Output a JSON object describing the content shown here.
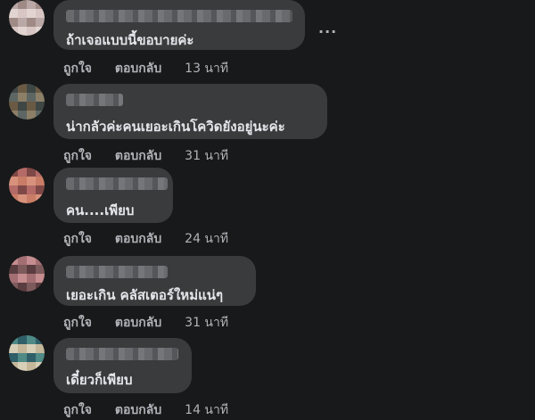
{
  "comments": [
    {
      "text": "ถ้าเจอแบบนี้ขอบายค่ะ",
      "like": "ถูกใจ",
      "reply": "ตอบกลับ",
      "time": "13 นาที",
      "avatar_colors": [
        "#b9a8a5",
        "#d7c6c3",
        "#9f8a86",
        "#e2d4d1"
      ]
    },
    {
      "text": "น่ากลัวค่ะคนเยอะเกินโควิดยังอยู่นะค่ะ",
      "like": "ถูกใจ",
      "reply": "ตอบกลับ",
      "time": "31 นาที",
      "avatar_colors": [
        "#5d6663",
        "#3f4744",
        "#8c7f68",
        "#6b5a43"
      ]
    },
    {
      "text": "คน....เพียบ",
      "like": "ถูกใจ",
      "reply": "ตอบกลับ",
      "time": "24 นาที",
      "avatar_colors": [
        "#b46a67",
        "#d8927c",
        "#7e4846",
        "#c97c66"
      ]
    },
    {
      "text": "เยอะเกิน คลัสเตอร์ใหม่แน่ๆ",
      "like": "ถูกใจ",
      "reply": "ตอบกลับ",
      "time": "31 นาที",
      "avatar_colors": [
        "#7d5a5c",
        "#a36f73",
        "#5a3d40",
        "#c58d8f"
      ]
    },
    {
      "text": "เดี๋ยวก็เพียบ",
      "like": "ถูกใจ",
      "reply": "ตอบกลับ",
      "time": "14 นาที",
      "avatar_colors": [
        "#4f8a86",
        "#c4b79a",
        "#2f5f69",
        "#d8cfb8"
      ]
    }
  ],
  "more_options": "···"
}
